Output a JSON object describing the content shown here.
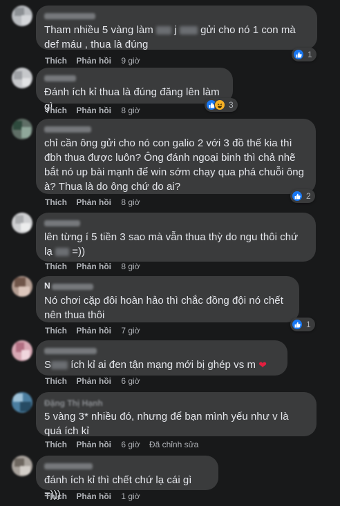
{
  "labels": {
    "like": "Thích",
    "reply": "Phản hồi",
    "edited": "Đã chỉnh sửa"
  },
  "comments": [
    {
      "text_a": "Tham nhiều 5 vàng làm ",
      "text_b": " j ",
      "text_c": " gửi cho nó 1 con mà def máu , thua là đúng",
      "time": "9 giờ",
      "reactions": {
        "types": [
          "like-icon"
        ],
        "count": "1"
      }
    },
    {
      "text": "Đánh ích kỉ thua là đúng đăng lên làm gì",
      "time": "8 giờ",
      "reactions": {
        "types": [
          "like-icon",
          "haha-icon"
        ],
        "count": "3"
      }
    },
    {
      "text": "chỉ cần ông gửi cho nó con galio 2 với 3 đồ thế kia thì đbh thua được luôn? Ông đánh ngoại binh thì chả nhẽ bắt nó up bài mạnh để win sớm chạy qua phá chuỗi ông à? Thua là do ông chứ do ai?",
      "time": "8 giờ",
      "reactions": {
        "types": [
          "like-icon"
        ],
        "count": "2"
      }
    },
    {
      "text_a": "lên từng í 5 tiền 3 sao mà vẫn thua thỳ do ngu thôi chứ lạ ",
      "text_b": " =))",
      "time": "8 giờ"
    },
    {
      "author_initial": "N",
      "text": "Nó chơi cặp đôi hoàn hảo thì chắc đồng đội nó chết nên thua thôi",
      "time": "7 giờ",
      "reactions": {
        "types": [
          "like-icon"
        ],
        "count": "1"
      }
    },
    {
      "text_a": "S",
      "text_b": " ích kỉ ai đen tận mạng mới bị ghép vs m ",
      "time": "6 giờ"
    },
    {
      "author": "Đặng Thị Hạnh",
      "text": "5 vàng 3* nhiều đó, nhưng để bạn mình yếu như v là quá ích kỉ",
      "time": "6 giờ",
      "edited": true
    },
    {
      "text": "đánh ích kỉ thì chết chứ lạ cái gì =)))",
      "time": "1 giờ"
    }
  ],
  "colors": {
    "background": "#18191a",
    "bubble": "#3a3b3c",
    "text": "#e4e6eb",
    "muted": "#b0b3b8",
    "like_blue": "#1877f2",
    "heart_red": "#e41e3f"
  }
}
